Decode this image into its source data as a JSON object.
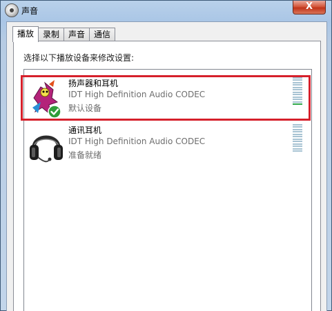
{
  "window": {
    "title": "声音",
    "close_label": "X"
  },
  "tabs": [
    {
      "label": "播放",
      "active": true
    },
    {
      "label": "录制",
      "active": false
    },
    {
      "label": "声音",
      "active": false
    },
    {
      "label": "通信",
      "active": false
    }
  ],
  "playback": {
    "instruction": "选择以下播放设备来修改设置:",
    "devices": [
      {
        "name": "扬声器和耳机",
        "description": "IDT High Definition Audio CODEC",
        "status": "默认设备",
        "icon": "speaker-default-icon",
        "is_default": true,
        "level": 0.08
      },
      {
        "name": "通讯耳机",
        "description": "IDT High Definition Audio CODEC",
        "status": "准备就绪",
        "icon": "headphones-icon",
        "is_default": false,
        "level": 0
      }
    ]
  },
  "colors": {
    "highlight": "#d6202b",
    "meter_active": "#2fa84a",
    "meter_idle": "#a7c3d3"
  }
}
